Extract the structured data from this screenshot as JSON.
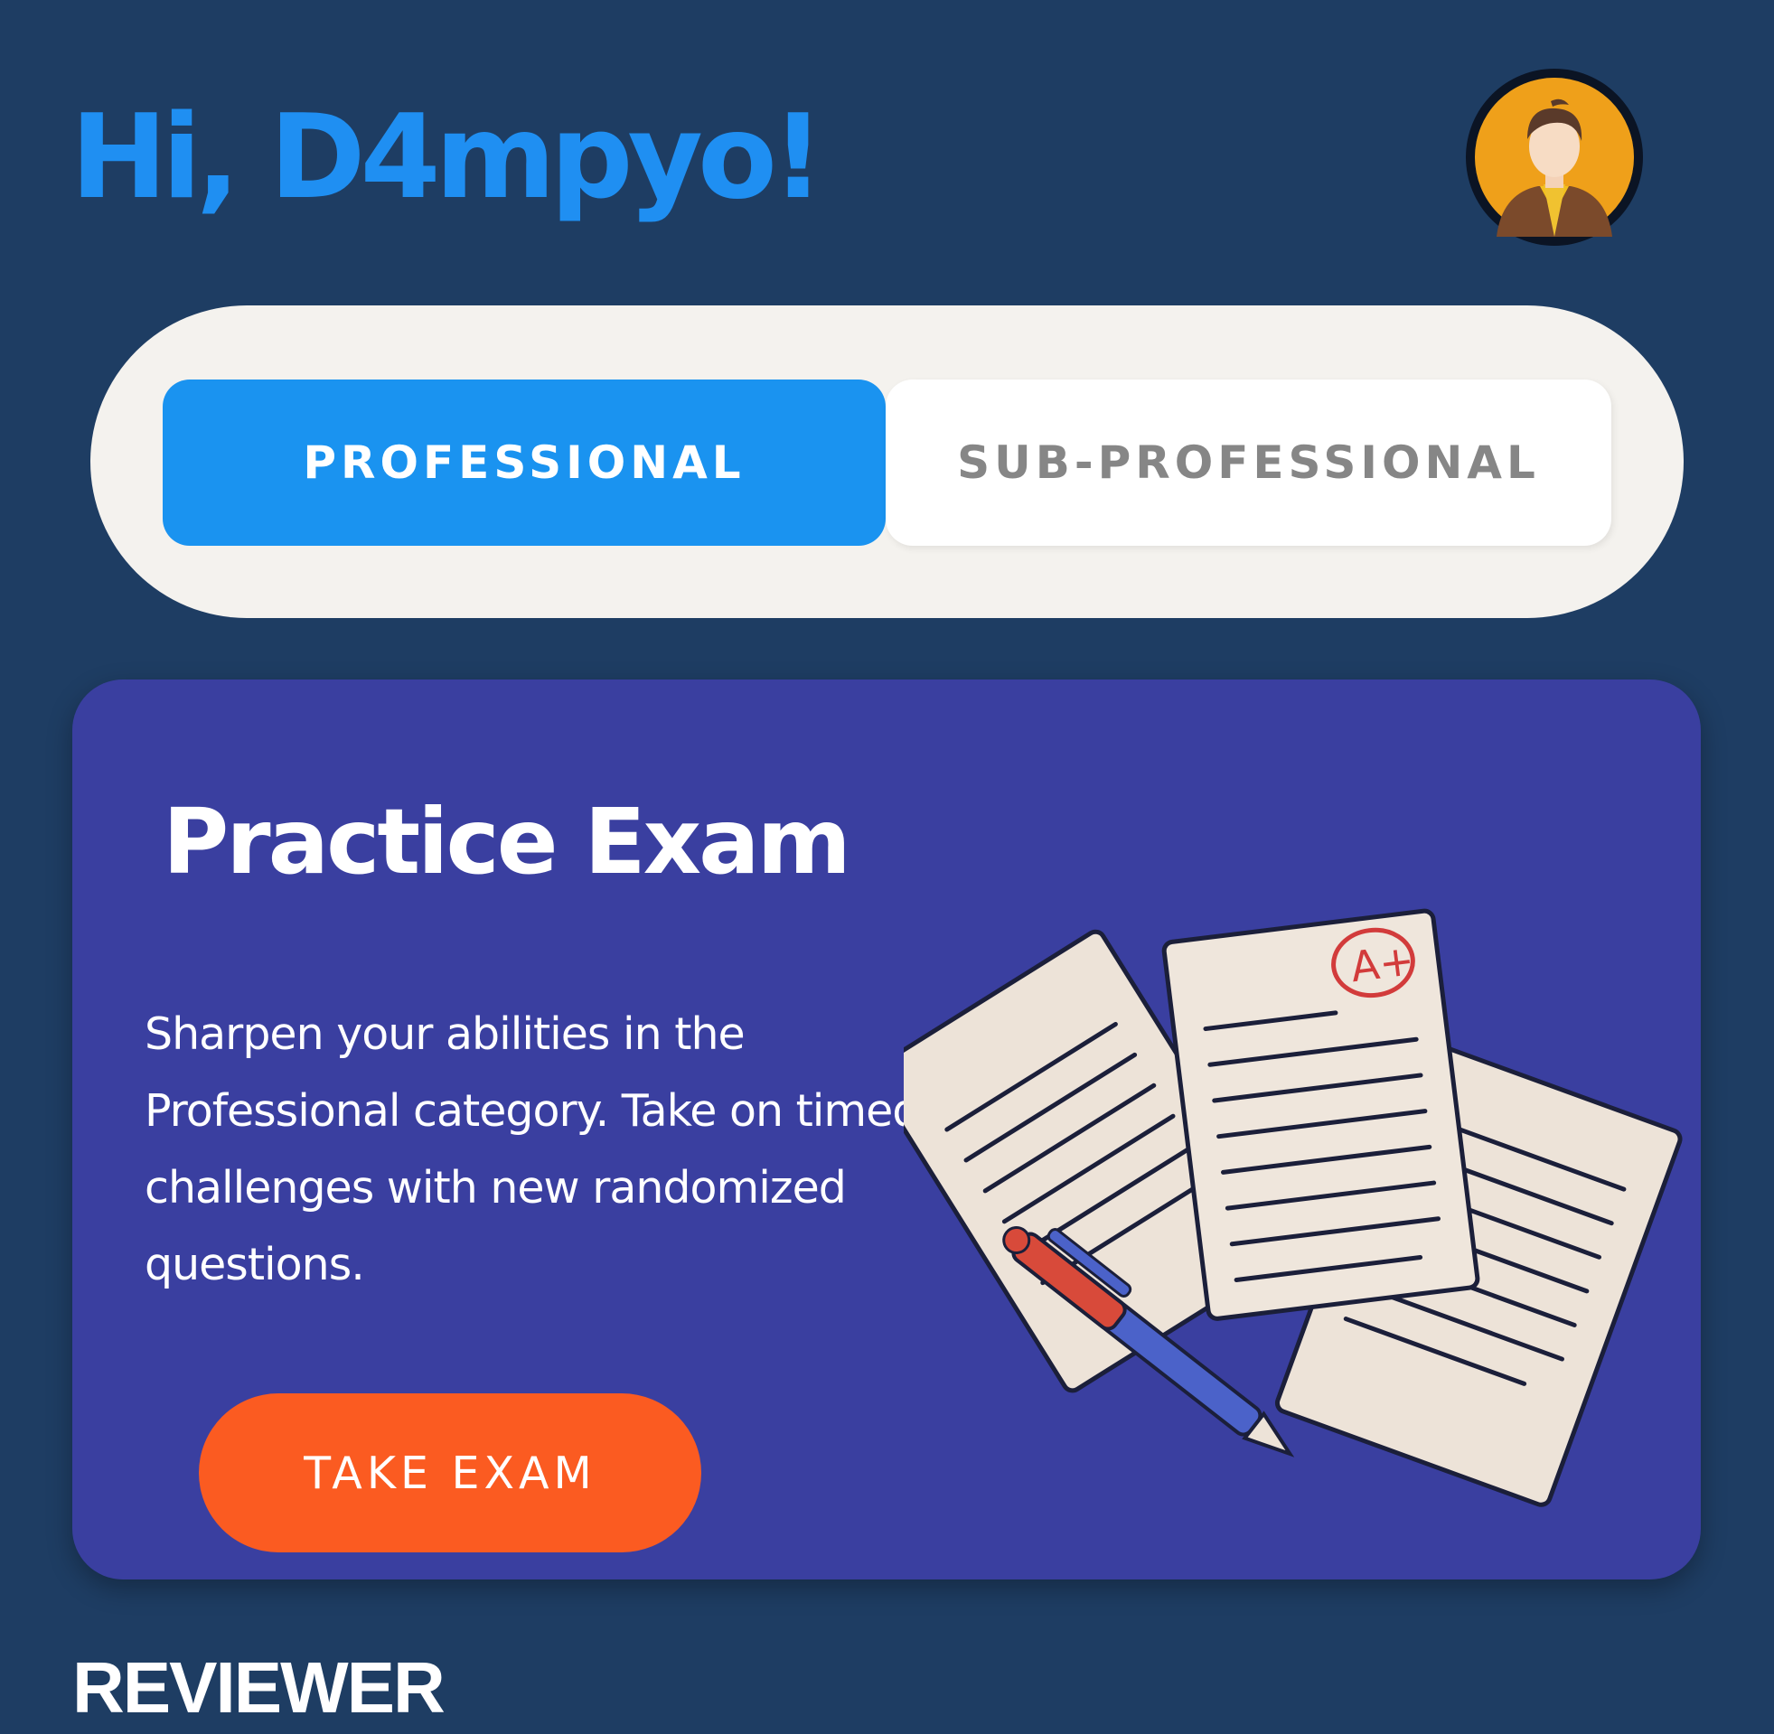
{
  "header": {
    "greeting": "Hi, D4mpyo!",
    "avatar_icon": "user-avatar-icon"
  },
  "category_toggle": {
    "options": [
      {
        "label": "PROFESSIONAL",
        "selected": true
      },
      {
        "label": "SUB-PROFESSIONAL",
        "selected": false
      }
    ]
  },
  "practice_card": {
    "title": "Practice Exam",
    "description": "Sharpen your abilities in the Professional category. Take on timed challenges with new randomized questions.",
    "button_label": "TAKE EXAM",
    "illustration_icon": "exam-papers-icon",
    "grade_mark": "A+"
  },
  "reviewer_section": {
    "label": "REVIEWER"
  },
  "colors": {
    "background": "#1e3d63",
    "accent_blue": "#1a93f0",
    "card": "#3a3fa0",
    "cta_orange": "#fb5b21",
    "toggle_track": "#f4f2ee"
  }
}
